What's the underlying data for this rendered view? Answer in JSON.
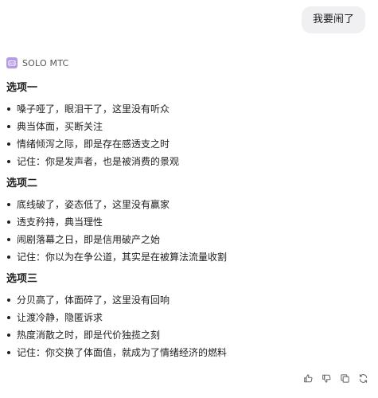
{
  "user_message": "我要闹了",
  "assistant": {
    "name": "SOLO MTC",
    "avatar_color": "#b79be8",
    "icon": "bot-icon"
  },
  "sections": [
    {
      "title": "选项一",
      "items": [
        "嗓子哑了，眼泪干了，这里没有听众",
        "典当体面，买断关注",
        "情绪倾泻之际，即是存在感透支之时",
        "记住：你是发声者，也是被消费的景观"
      ]
    },
    {
      "title": "选项二",
      "items": [
        "底线破了，姿态低了，这里没有赢家",
        "透支矜持，典当理性",
        "闹剧落幕之日，即是信用破产之始",
        "记住：你以为在争公道，其实是在被算法流量收割"
      ]
    },
    {
      "title": "选项三",
      "items": [
        "分贝高了，体面碎了，这里没有回响",
        "让渡冷静，隐匿诉求",
        "热度消散之时，即是代价独揽之刻",
        "记住：你交换了体面值，就成为了情绪经济的燃料"
      ]
    }
  ],
  "actions": [
    "thumbs-up-icon",
    "thumbs-down-icon",
    "copy-icon",
    "regenerate-icon"
  ]
}
